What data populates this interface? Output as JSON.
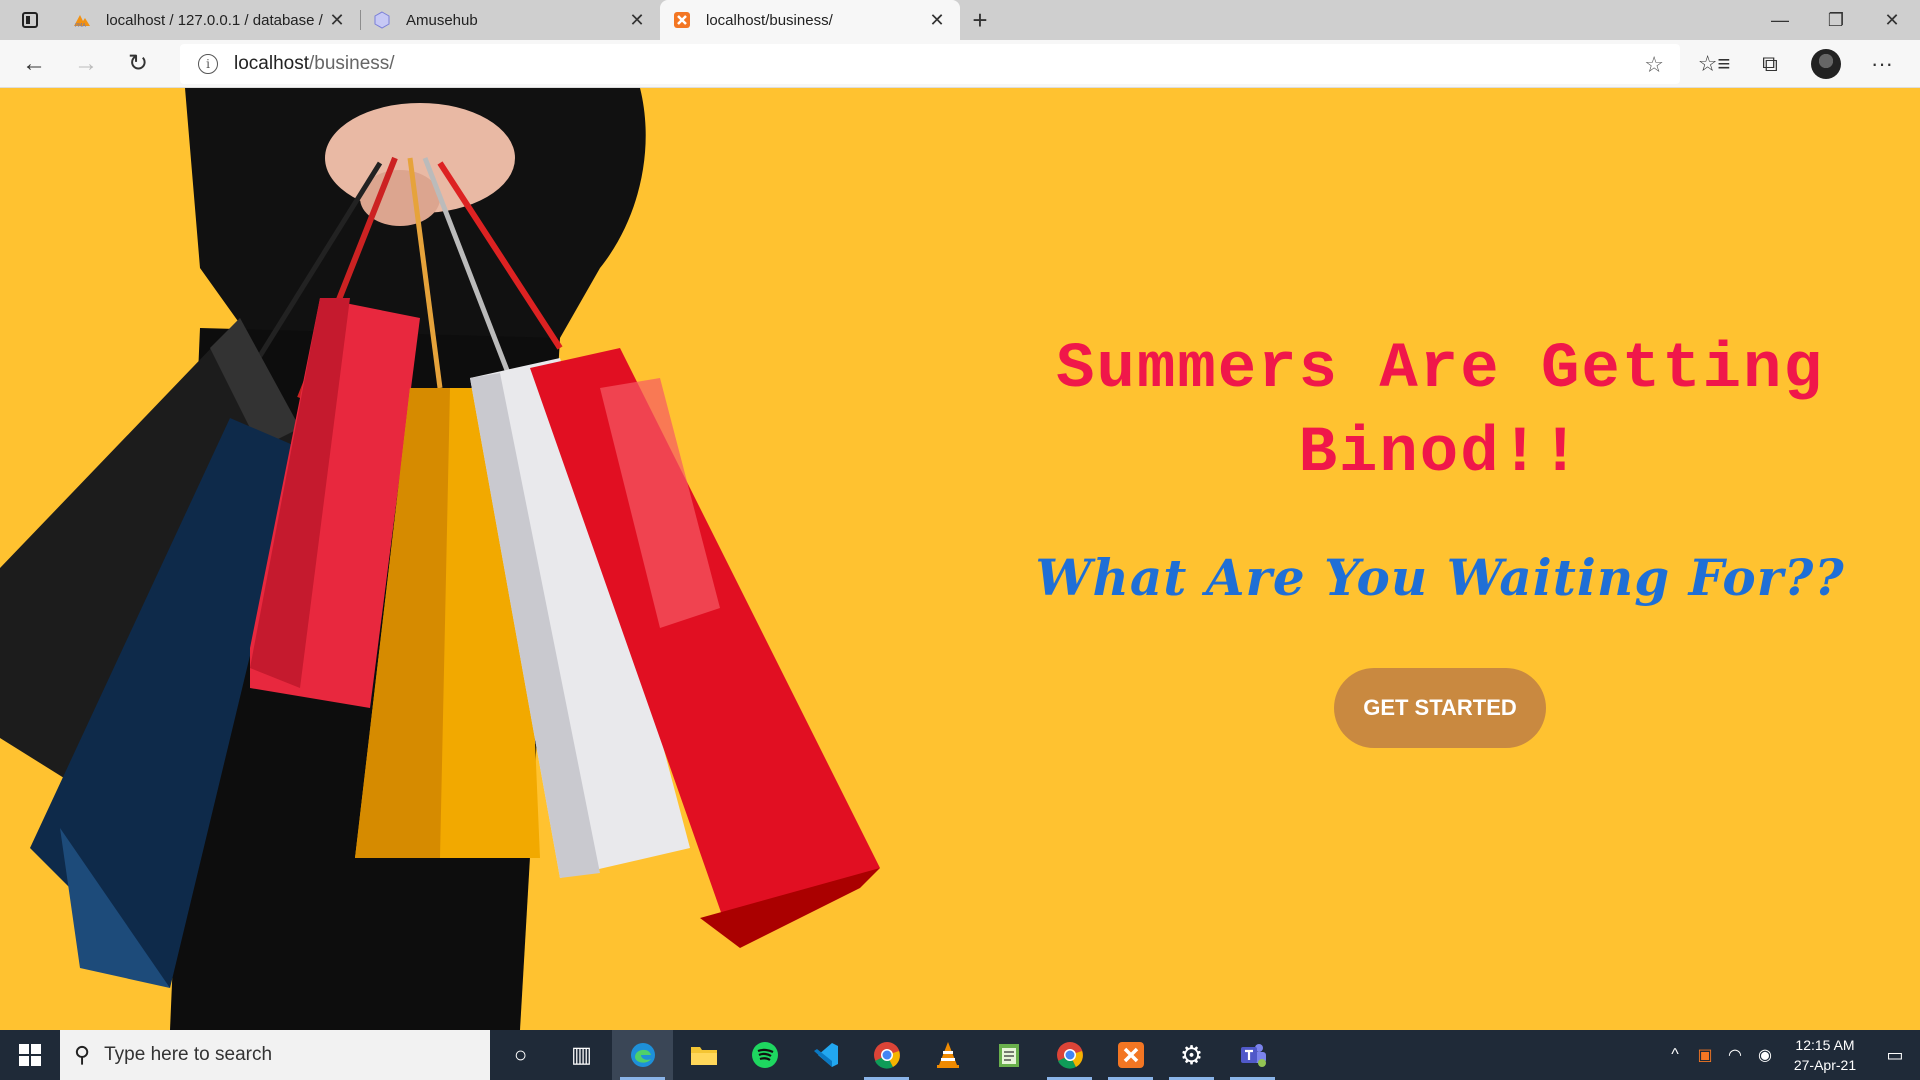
{
  "browser": {
    "tabs": [
      {
        "title": "localhost / 127.0.0.1 / database /",
        "icon": "phpmyadmin-icon",
        "active": false
      },
      {
        "title": "Amusehub",
        "icon": "amusehub-icon",
        "active": false
      },
      {
        "title": "localhost/business/",
        "icon": "xampp-icon",
        "active": true
      }
    ],
    "address": {
      "host": "localhost",
      "path": "/business/"
    }
  },
  "hero": {
    "headline_line1": "Summers Are Getting",
    "headline_line2": "Binod!!",
    "subheadline": "What Are You Waiting For??",
    "cta_label": "GET STARTED",
    "background_color": "#ffc230",
    "headline_color": "#f0174a",
    "subheadline_color": "#1f6fd6",
    "cta_color": "#c98940"
  },
  "taskbar": {
    "search_placeholder": "Type here to search",
    "time": "12:15 AM",
    "date": "27-Apr-21",
    "pinned": [
      "cortana-icon",
      "task-view-icon",
      "edge-icon",
      "file-explorer-icon",
      "spotify-icon",
      "vscode-icon",
      "chrome-icon",
      "vlc-icon",
      "notepad-icon",
      "chrome-profile-icon",
      "xampp-icon",
      "settings-icon",
      "teams-icon"
    ]
  }
}
